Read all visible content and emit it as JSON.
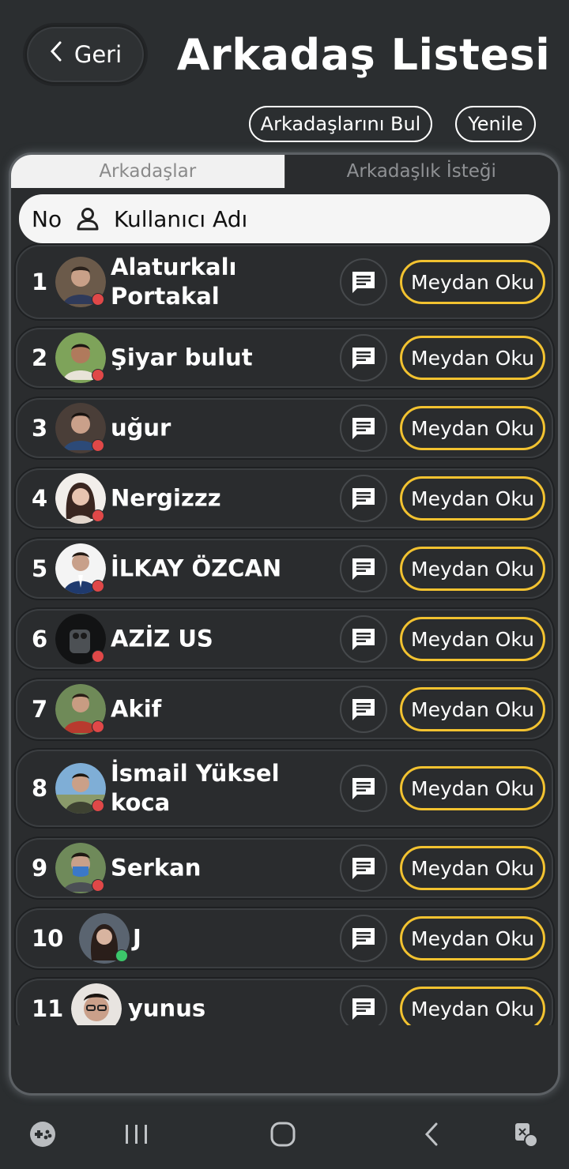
{
  "header": {
    "back_label": "Geri",
    "title": "Arkadaş Listesi",
    "find_friends_label": "Arkadaşlarını Bul",
    "refresh_label": "Yenile"
  },
  "tabs": [
    {
      "label": "Arkadaşlar",
      "active": true
    },
    {
      "label": "Arkadaşlık İsteği",
      "active": false
    }
  ],
  "table_header": {
    "no": "No",
    "username": "Kullanıcı Adı"
  },
  "challenge_label": "Meydan Oku",
  "colors": {
    "accent": "#f2c230",
    "offline": "#e04848",
    "online": "#3cc66a",
    "background": "#2b2e30"
  },
  "friends": [
    {
      "no": "1",
      "name": "Alaturkalı Portakal",
      "status": "offline"
    },
    {
      "no": "2",
      "name": "Şiyar bulut",
      "status": "offline"
    },
    {
      "no": "3",
      "name": "uğur",
      "status": "offline"
    },
    {
      "no": "4",
      "name": "Nergizzz",
      "status": "offline"
    },
    {
      "no": "5",
      "name": "İLKAY ÖZCAN",
      "status": "offline"
    },
    {
      "no": "6",
      "name": "AZİZ US",
      "status": "offline"
    },
    {
      "no": "7",
      "name": "Akif",
      "status": "offline"
    },
    {
      "no": "8",
      "name": "İsmail Yüksel koca",
      "status": "offline"
    },
    {
      "no": "9",
      "name": "Serkan",
      "status": "offline"
    },
    {
      "no": "10",
      "name": "J",
      "status": "online"
    },
    {
      "no": "11",
      "name": "yunus",
      "status": "offline"
    }
  ],
  "navbar": {
    "icons": [
      "game-launcher-icon",
      "recent-apps-icon",
      "home-icon",
      "back-icon",
      "assistant-icon"
    ]
  }
}
